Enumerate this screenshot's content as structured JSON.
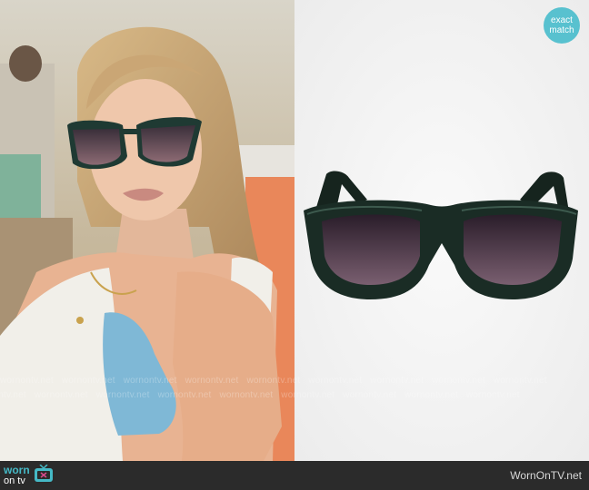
{
  "badge": {
    "line1": "exact",
    "line2": "match",
    "color": "#58c1cf"
  },
  "footer": {
    "logo_line1": "worn",
    "logo_line2": "on tv",
    "site": "WornOnTV.net"
  },
  "watermark": {
    "text": "wornontv.net"
  },
  "icons": [
    "tv-icon"
  ],
  "colors": {
    "accent": "#45b9c6",
    "footer_bg": "#2b2b2b",
    "frame_green": "#1f2e27"
  }
}
